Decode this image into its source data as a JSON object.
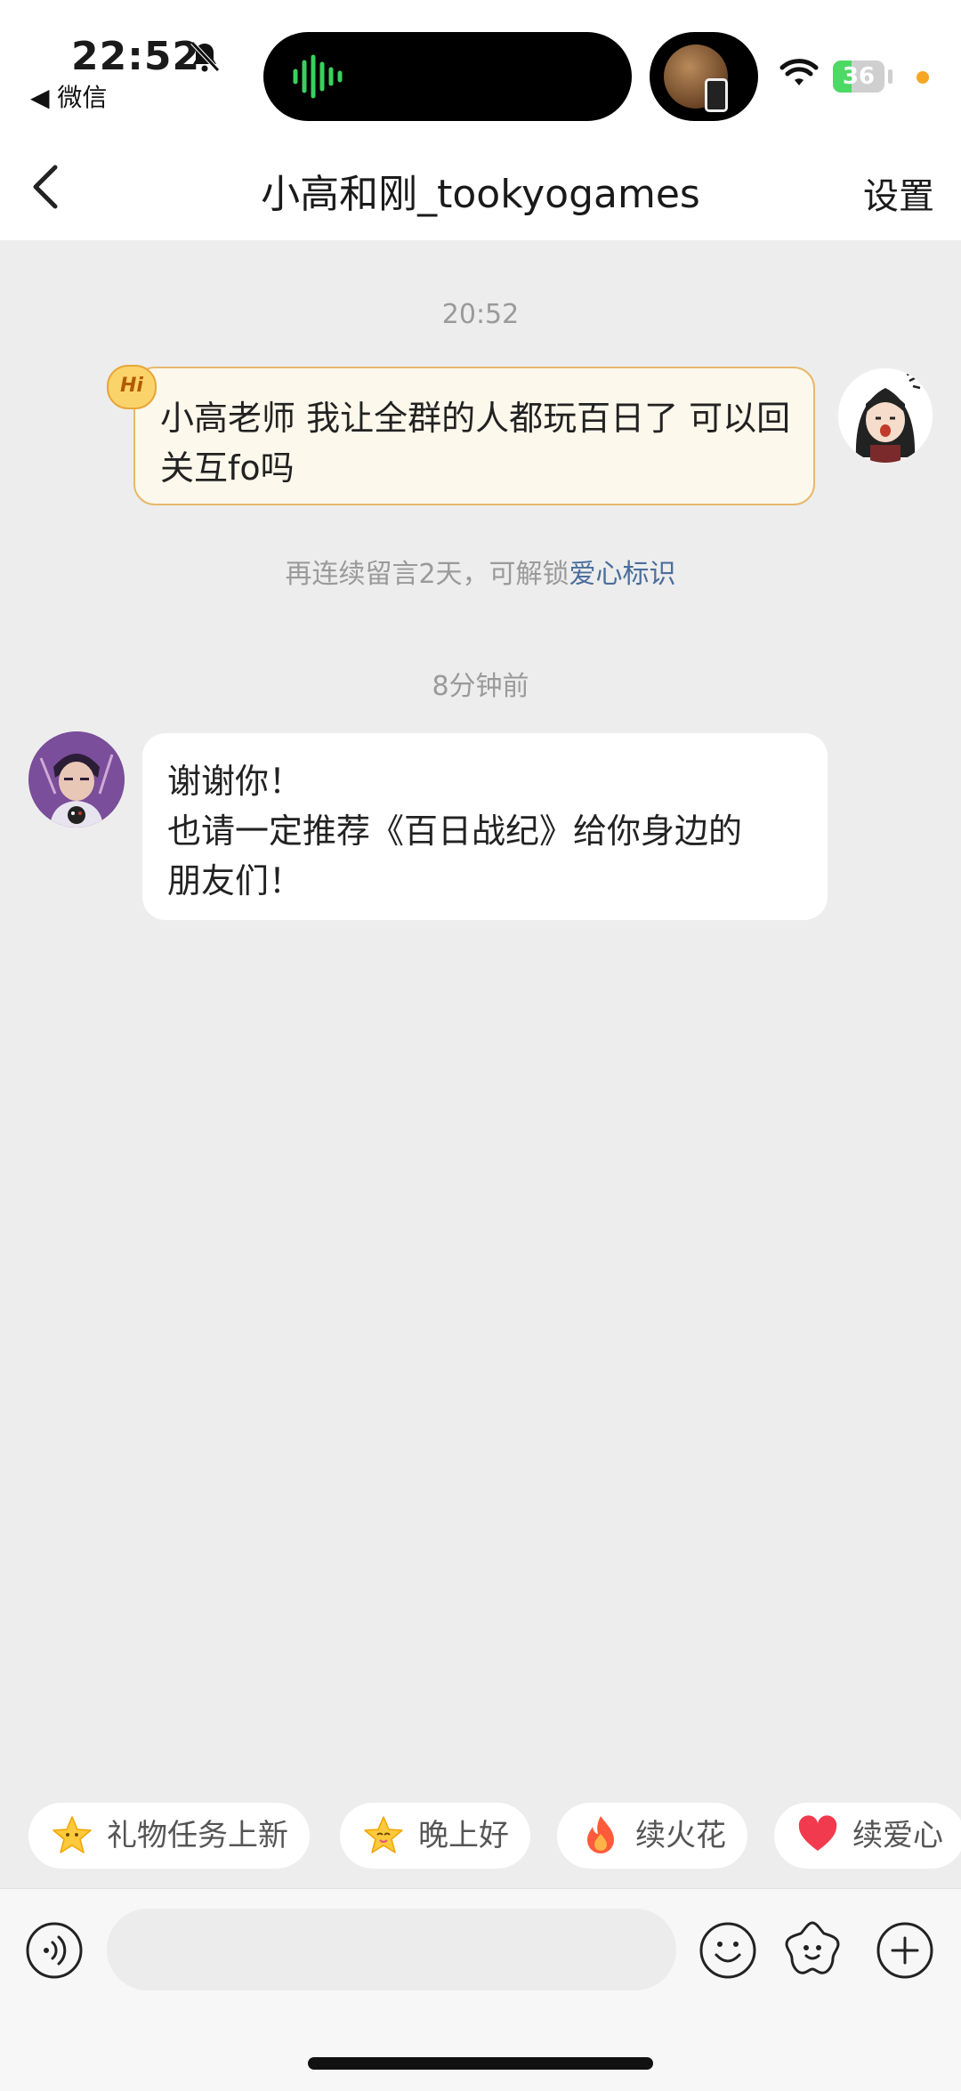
{
  "status_bar": {
    "time": "22:52",
    "back_app": "◀ 微信",
    "battery": "36",
    "battery_level": 0.36,
    "icons": [
      "bell-slash-icon",
      "waveform-icon",
      "wifi-icon",
      "battery-icon"
    ]
  },
  "nav": {
    "title": "小高和刚_tookyogames",
    "settings": "设置",
    "back_icon": "chevron-left-icon"
  },
  "chat": {
    "ts1": "20:52",
    "sent_badge": "Hi",
    "sent_message": "小高老师 我让全群的人都玩百日了 可以回关互fo吗",
    "notice_prefix": "再连续留言2天，可解锁",
    "notice_link": "爱心标识",
    "ts2": "8分钟前",
    "recv_line1": "谢谢你！",
    "recv_line2": "也请一定推荐《百日战纪》给你身边的",
    "recv_line3": "朋友们！"
  },
  "chips": [
    {
      "label": "礼物任务上新",
      "icon": "star-icon"
    },
    {
      "label": "晚上好",
      "icon": "smiling-star-icon"
    },
    {
      "label": "续火花",
      "icon": "flame-icon"
    },
    {
      "label": "续爱心",
      "icon": "heart-icon"
    }
  ],
  "input_bar": {
    "placeholder": "",
    "icons": [
      "voice-icon",
      "emoji-icon",
      "sticker-icon",
      "plus-icon"
    ]
  },
  "colors": {
    "accent_link": "#4a6e9c",
    "bubble_border": "#e8b86a",
    "background": "#ededed"
  }
}
